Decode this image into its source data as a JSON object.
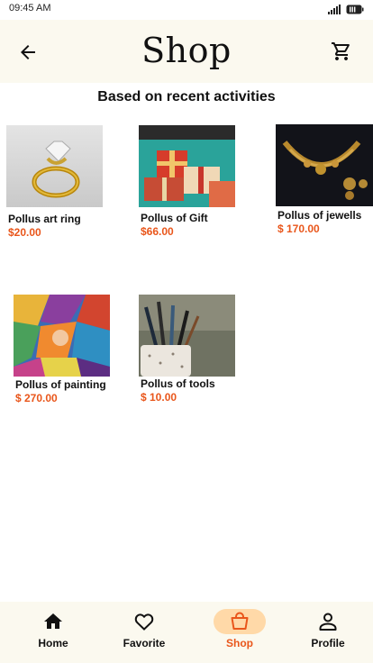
{
  "status_bar": {
    "time": "09:45 AM"
  },
  "header": {
    "title": "Shop",
    "back_icon": "arrow-left-icon",
    "cart_icon": "cart-icon"
  },
  "section": {
    "title": "Based on recent activities"
  },
  "products": [
    {
      "name": "Pollus art ring",
      "price": "$20.00",
      "image": "gold-ring"
    },
    {
      "name": "Pollus of Gift",
      "price": "$66.00",
      "image": "gift-boxes"
    },
    {
      "name": "Pollus of jewells",
      "price": "$ 170.00",
      "image": "gold-necklace"
    },
    {
      "name": "Pollus of painting",
      "price": "$ 270.00",
      "image": "abstract-painting"
    },
    {
      "name": "Pollus of tools",
      "price": "$ 10.00",
      "image": "paint-brushes"
    }
  ],
  "nav": {
    "items": [
      {
        "label": "Home",
        "icon": "home-icon"
      },
      {
        "label": "Favorite",
        "icon": "heart-icon"
      },
      {
        "label": "Shop",
        "icon": "shopping-bag-icon",
        "active": true
      },
      {
        "label": "Profile",
        "icon": "person-icon"
      }
    ]
  },
  "colors": {
    "accent": "#e9561b",
    "header_bg": "#fbf9ef",
    "active_pill": "#ffd9a8"
  }
}
